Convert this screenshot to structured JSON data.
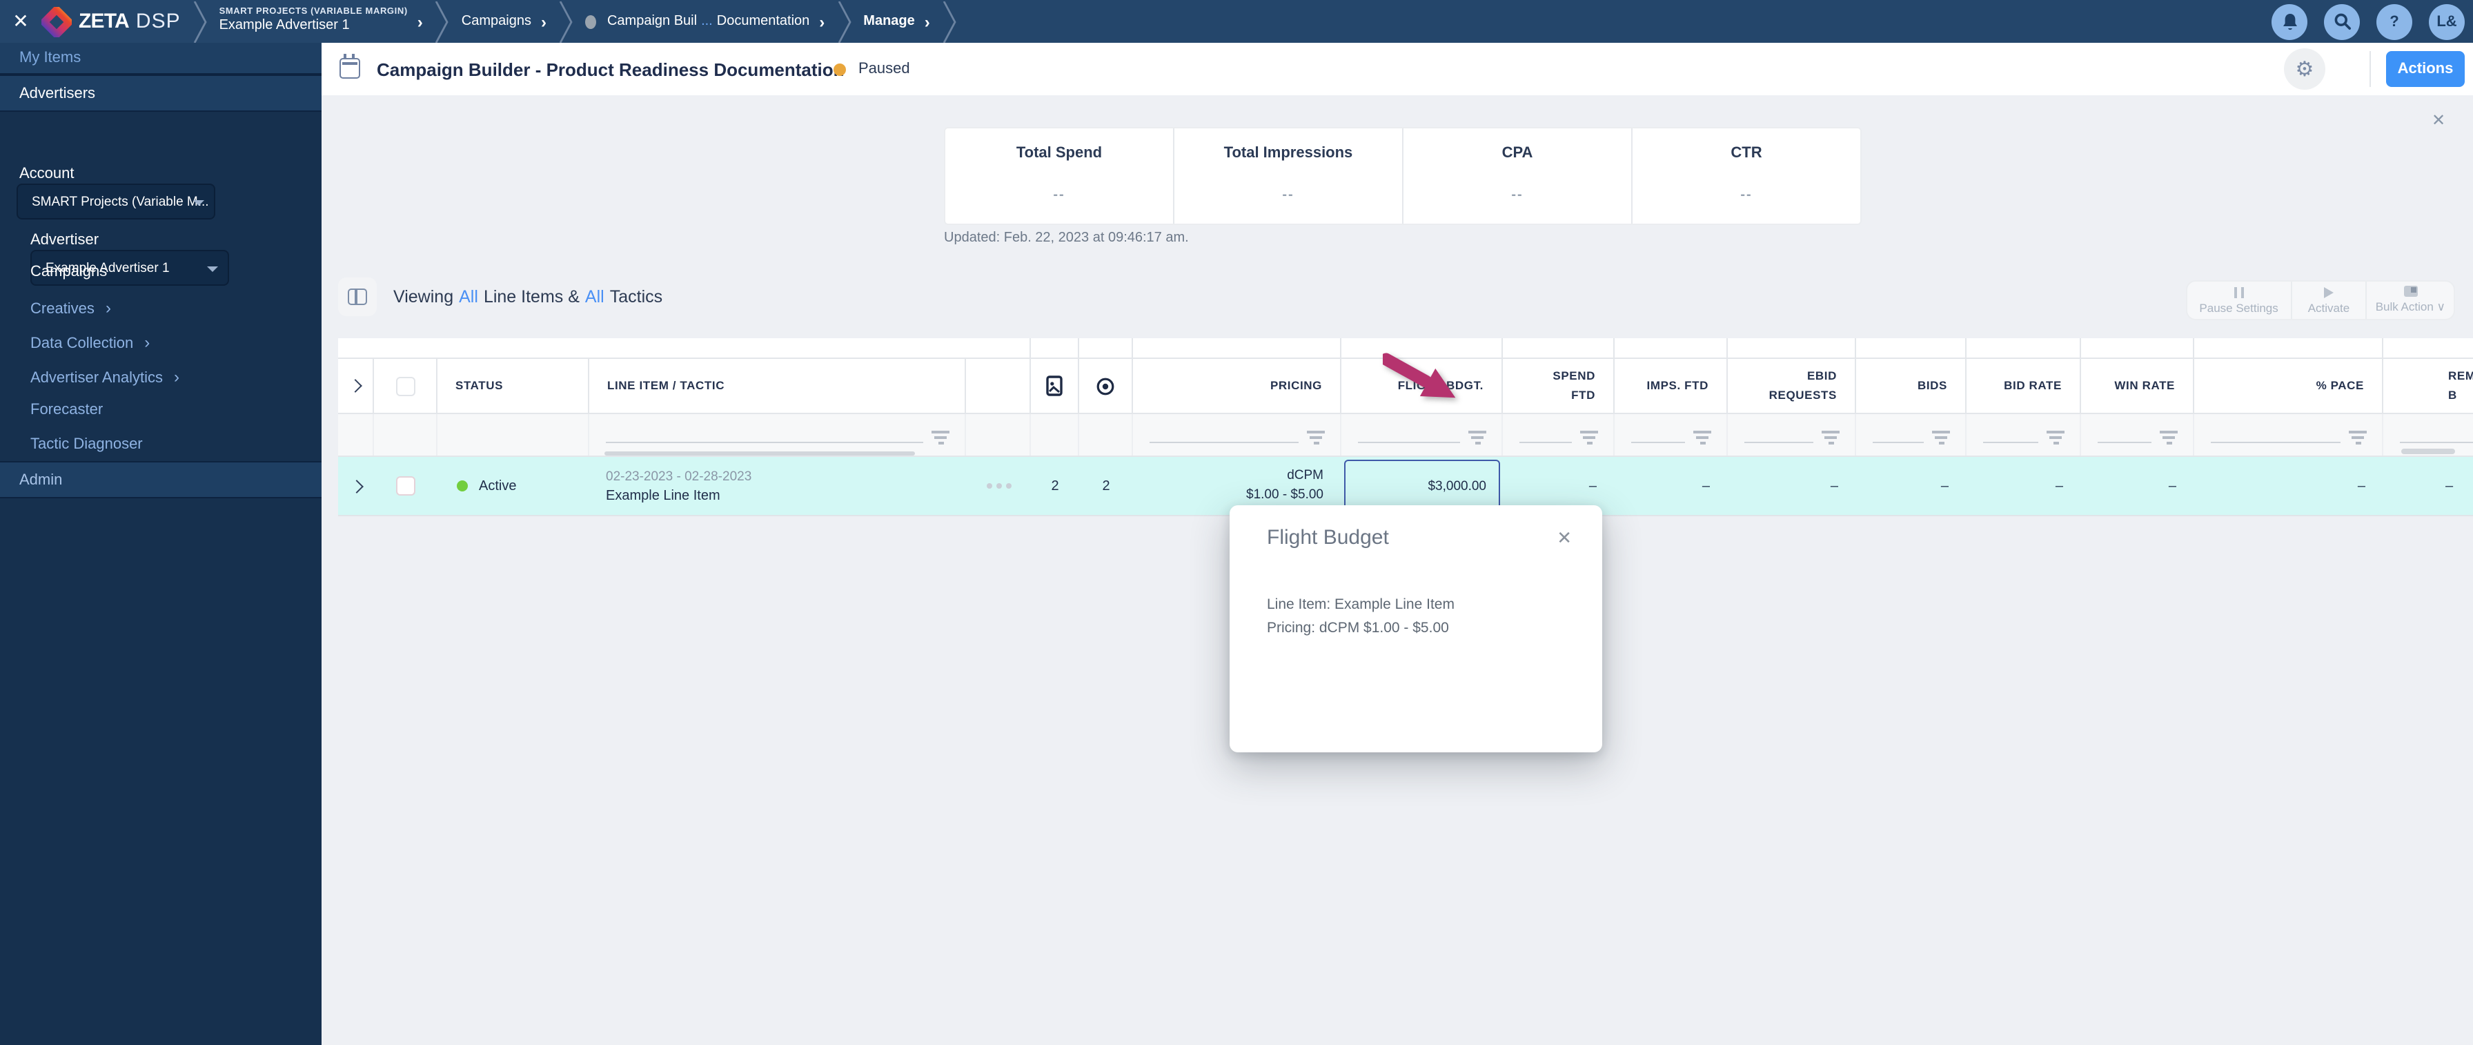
{
  "colors": {
    "nav-bg": "#24466b",
    "sidebar-bg": "#16304e",
    "sidebar-band": "#1e3f63",
    "accent": "#3d93f8",
    "link": "#4a90f5",
    "paused": "#e9a63c",
    "active": "#72ce3e",
    "row-highlight": "#d3f8f5",
    "arrow": "#b5336e"
  },
  "topnav": {
    "brand": "ZETA",
    "brand_suffix": "DSP",
    "crumb_account": "SMART PROJECTS (VARIABLE MARGIN)",
    "crumb_advertiser": "Example Advertiser 1",
    "crumb_campaigns": "Campaigns",
    "crumb_campaign_a": "Campaign Buil",
    "crumb_campaign_dots": "...",
    "crumb_campaign_b": "Documentation",
    "crumb_manage": "Manage",
    "help_label": "?",
    "avatar": "L&"
  },
  "sidebar": {
    "my_items": "My Items",
    "advertisers": "Advertisers",
    "account_label": "Account",
    "account_value": "SMART Projects (Variable M...",
    "advertiser_label": "Advertiser",
    "advertiser_value": "Example Advertiser 1",
    "campaigns": "Campaigns",
    "creatives": "Creatives",
    "data_collection": "Data Collection",
    "advertiser_analytics": "Advertiser Analytics",
    "forecaster": "Forecaster",
    "tactic_diagnoser": "Tactic Diagnoser",
    "admin": "Admin"
  },
  "header": {
    "title": "Campaign Builder - Product Readiness Documentation",
    "status": "Paused",
    "actions": "Actions"
  },
  "stats": {
    "cards": [
      {
        "label": "Total Spend",
        "value": "--"
      },
      {
        "label": "Total Impressions",
        "value": "--"
      },
      {
        "label": "CPA",
        "value": "--"
      },
      {
        "label": "CTR",
        "value": "--"
      }
    ],
    "updated": "Updated: Feb. 22, 2023 at 09:46:17 am."
  },
  "toolbar": {
    "viewing_prefix": "Viewing",
    "all_items": "All",
    "line_items": "Line Items &",
    "all_tactics": "All",
    "tactics": "Tactics",
    "pause_settings": "Pause Settings",
    "activate": "Activate",
    "bulk_action": "Bulk Action ∨"
  },
  "table": {
    "headers": {
      "status": "STATUS",
      "line_item": "LINE ITEM / TACTIC",
      "pricing": "PRICING",
      "flight_budget": "FLIGHT BDGT.",
      "spend_ftd": "SPEND FTD",
      "imps_ftd": "IMPS. FTD",
      "ebid_requests": "EBID REQUESTS",
      "bids": "BIDS",
      "bid_rate": "BID RATE",
      "win_rate": "WIN RATE",
      "pace": "% PACE",
      "rem_line1": "REM",
      "rem_line2": "B"
    },
    "row": {
      "status": "Active",
      "dates": "02-23-2023 - 02-28-2023",
      "name": "Example Line Item",
      "creatives_count": "2",
      "tactics_count": "2",
      "pricing_type": "dCPM",
      "pricing_range": "$1.00 - $5.00",
      "flight_budget": "$3,000.00",
      "dash": "–"
    }
  },
  "popup": {
    "title": "Flight Budget",
    "line1": "Line Item: Example Line Item",
    "line2": "Pricing: dCPM $1.00 - $5.00"
  }
}
